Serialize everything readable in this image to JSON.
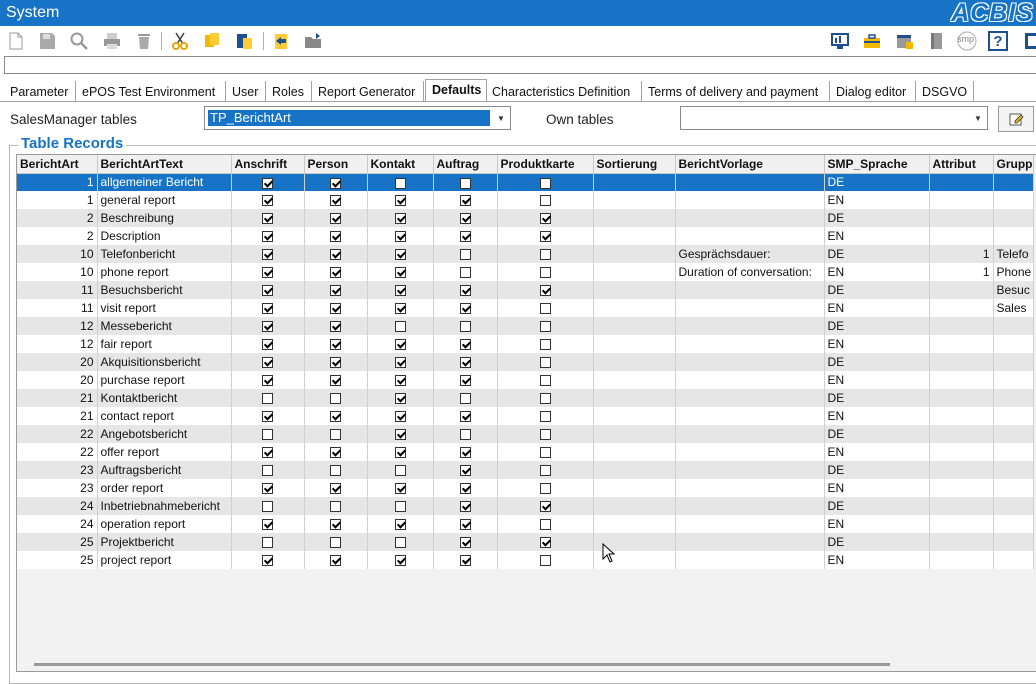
{
  "window": {
    "title": "System",
    "brand": "ACBIS"
  },
  "toolbar": {
    "icons": [
      "new-icon",
      "save-icon",
      "search-icon",
      "print-icon",
      "delete-icon",
      "cut-icon",
      "copy-icon",
      "paste-icon",
      "import-icon",
      "open-folder-icon",
      "monitor-icon",
      "briefcase-icon",
      "calendar-icon",
      "book-icon",
      "smp-icon",
      "help-icon",
      "exit-icon"
    ],
    "smp_label": "smp",
    "help_label": "?"
  },
  "command_line": {
    "value": ""
  },
  "tabs": [
    {
      "label": "Parameter"
    },
    {
      "label": "ePOS Test Environment"
    },
    {
      "label": "User"
    },
    {
      "label": "Roles"
    },
    {
      "label": "Report Generator"
    },
    {
      "label": "Defaults"
    },
    {
      "label": "Characteristics Definition"
    },
    {
      "label": "Terms of delivery and payment"
    },
    {
      "label": "Dialog editor"
    },
    {
      "label": "DSGVO"
    }
  ],
  "active_tab": "Defaults",
  "filters": {
    "salesmanager_label": "SalesManager tables",
    "salesmanager_value": "TP_BerichtArt",
    "own_label": "Own tables",
    "own_value": ""
  },
  "records": {
    "legend": "Table Records",
    "columns": [
      "BerichtArt",
      "BerichtArtText",
      "Anschrift",
      "Person",
      "Kontakt",
      "Auftrag",
      "Produktkarte",
      "Sortierung",
      "BerichtVorlage",
      "SMP_Sprache",
      "Attribut",
      "Grupp"
    ],
    "rows": [
      {
        "art": "1",
        "text": "allgemeiner Bericht",
        "anschrift": true,
        "person": true,
        "kontakt": false,
        "auftrag": false,
        "produkt": false,
        "sort": "",
        "vorlage": "",
        "sprache": "DE",
        "attribut": "",
        "gruppe": ""
      },
      {
        "art": "1",
        "text": "general report",
        "anschrift": true,
        "person": true,
        "kontakt": true,
        "auftrag": true,
        "produkt": false,
        "sort": "",
        "vorlage": "",
        "sprache": "EN",
        "attribut": "",
        "gruppe": ""
      },
      {
        "art": "2",
        "text": "Beschreibung",
        "anschrift": true,
        "person": true,
        "kontakt": true,
        "auftrag": true,
        "produkt": true,
        "sort": "",
        "vorlage": "",
        "sprache": "DE",
        "attribut": "",
        "gruppe": ""
      },
      {
        "art": "2",
        "text": "Description",
        "anschrift": true,
        "person": true,
        "kontakt": true,
        "auftrag": true,
        "produkt": true,
        "sort": "",
        "vorlage": "",
        "sprache": "EN",
        "attribut": "",
        "gruppe": ""
      },
      {
        "art": "10",
        "text": "Telefonbericht",
        "anschrift": true,
        "person": true,
        "kontakt": true,
        "auftrag": false,
        "produkt": false,
        "sort": "",
        "vorlage": "Gesprächsdauer:",
        "sprache": "DE",
        "attribut": "1",
        "gruppe": "Telefo"
      },
      {
        "art": "10",
        "text": "phone report",
        "anschrift": true,
        "person": true,
        "kontakt": true,
        "auftrag": false,
        "produkt": false,
        "sort": "",
        "vorlage": "Duration of conversation:",
        "sprache": "EN",
        "attribut": "1",
        "gruppe": "Phone"
      },
      {
        "art": "11",
        "text": "Besuchsbericht",
        "anschrift": true,
        "person": true,
        "kontakt": true,
        "auftrag": true,
        "produkt": true,
        "sort": "",
        "vorlage": "",
        "sprache": "DE",
        "attribut": "",
        "gruppe": "Besuc"
      },
      {
        "art": "11",
        "text": "visit report",
        "anschrift": true,
        "person": true,
        "kontakt": true,
        "auftrag": true,
        "produkt": false,
        "sort": "",
        "vorlage": "",
        "sprache": "EN",
        "attribut": "",
        "gruppe": "Sales"
      },
      {
        "art": "12",
        "text": "Messebericht",
        "anschrift": true,
        "person": true,
        "kontakt": false,
        "auftrag": false,
        "produkt": false,
        "sort": "",
        "vorlage": "",
        "sprache": "DE",
        "attribut": "",
        "gruppe": ""
      },
      {
        "art": "12",
        "text": "fair report",
        "anschrift": true,
        "person": true,
        "kontakt": true,
        "auftrag": true,
        "produkt": false,
        "sort": "",
        "vorlage": "",
        "sprache": "EN",
        "attribut": "",
        "gruppe": ""
      },
      {
        "art": "20",
        "text": "Akquisitionsbericht",
        "anschrift": true,
        "person": true,
        "kontakt": true,
        "auftrag": true,
        "produkt": false,
        "sort": "",
        "vorlage": "",
        "sprache": "DE",
        "attribut": "",
        "gruppe": ""
      },
      {
        "art": "20",
        "text": "purchase report",
        "anschrift": true,
        "person": true,
        "kontakt": true,
        "auftrag": true,
        "produkt": false,
        "sort": "",
        "vorlage": "",
        "sprache": "EN",
        "attribut": "",
        "gruppe": ""
      },
      {
        "art": "21",
        "text": "Kontaktbericht",
        "anschrift": false,
        "person": false,
        "kontakt": true,
        "auftrag": false,
        "produkt": false,
        "sort": "",
        "vorlage": "",
        "sprache": "DE",
        "attribut": "",
        "gruppe": ""
      },
      {
        "art": "21",
        "text": "contact report",
        "anschrift": true,
        "person": true,
        "kontakt": true,
        "auftrag": true,
        "produkt": false,
        "sort": "",
        "vorlage": "",
        "sprache": "EN",
        "attribut": "",
        "gruppe": ""
      },
      {
        "art": "22",
        "text": "Angebotsbericht",
        "anschrift": false,
        "person": false,
        "kontakt": true,
        "auftrag": false,
        "produkt": false,
        "sort": "",
        "vorlage": "",
        "sprache": "DE",
        "attribut": "",
        "gruppe": ""
      },
      {
        "art": "22",
        "text": "offer report",
        "anschrift": true,
        "person": true,
        "kontakt": true,
        "auftrag": true,
        "produkt": false,
        "sort": "",
        "vorlage": "",
        "sprache": "EN",
        "attribut": "",
        "gruppe": ""
      },
      {
        "art": "23",
        "text": "Auftragsbericht",
        "anschrift": false,
        "person": false,
        "kontakt": false,
        "auftrag": true,
        "produkt": false,
        "sort": "",
        "vorlage": "",
        "sprache": "DE",
        "attribut": "",
        "gruppe": ""
      },
      {
        "art": "23",
        "text": "order report",
        "anschrift": true,
        "person": true,
        "kontakt": true,
        "auftrag": true,
        "produkt": false,
        "sort": "",
        "vorlage": "",
        "sprache": "EN",
        "attribut": "",
        "gruppe": ""
      },
      {
        "art": "24",
        "text": "Inbetriebnahmebericht",
        "anschrift": false,
        "person": false,
        "kontakt": false,
        "auftrag": true,
        "produkt": true,
        "sort": "",
        "vorlage": "",
        "sprache": "DE",
        "attribut": "",
        "gruppe": ""
      },
      {
        "art": "24",
        "text": "operation report",
        "anschrift": true,
        "person": true,
        "kontakt": true,
        "auftrag": true,
        "produkt": false,
        "sort": "",
        "vorlage": "",
        "sprache": "EN",
        "attribut": "",
        "gruppe": ""
      },
      {
        "art": "25",
        "text": "Projektbericht",
        "anschrift": false,
        "person": false,
        "kontakt": false,
        "auftrag": true,
        "produkt": true,
        "sort": "",
        "vorlage": "",
        "sprache": "DE",
        "attribut": "",
        "gruppe": ""
      },
      {
        "art": "25",
        "text": "project report",
        "anschrift": true,
        "person": true,
        "kontakt": true,
        "auftrag": true,
        "produkt": false,
        "sort": "",
        "vorlage": "",
        "sprache": "EN",
        "attribut": "",
        "gruppe": ""
      }
    ]
  },
  "colors": {
    "accent": "#1773c6",
    "row_alt": "#e6e6e6",
    "grid_bg": "#f2f2f2"
  }
}
